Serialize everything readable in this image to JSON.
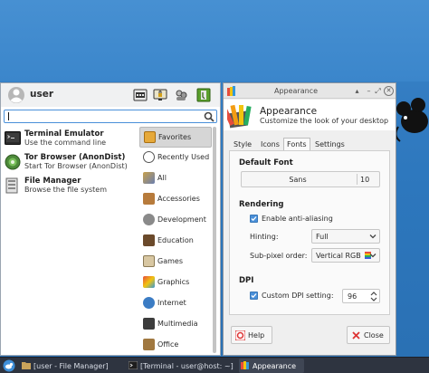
{
  "menu": {
    "user_name": "user",
    "header_buttons": [
      "settings-manager-icon",
      "lock-screen-icon",
      "switch-user-icon",
      "log-out-icon"
    ],
    "search": {
      "value": "",
      "placeholder": ""
    },
    "favorites": [
      {
        "name": "Terminal Emulator",
        "desc": "Use the command line",
        "icon": "terminal-icon"
      },
      {
        "name": "Tor Browser (AnonDist)",
        "desc": "Start Tor Browser (AnonDist)",
        "icon": "tor-browser-icon"
      },
      {
        "name": "File Manager",
        "desc": "Browse the file system",
        "icon": "file-manager-icon"
      }
    ],
    "categories": [
      {
        "label": "Favorites",
        "icon": "favorites-icon",
        "selected": true
      },
      {
        "label": "Recently Used",
        "icon": "recently-used-icon"
      },
      {
        "label": "All",
        "icon": "all-apps-icon"
      },
      {
        "label": "Accessories",
        "icon": "accessories-icon"
      },
      {
        "label": "Development",
        "icon": "development-icon"
      },
      {
        "label": "Education",
        "icon": "education-icon"
      },
      {
        "label": "Games",
        "icon": "games-icon"
      },
      {
        "label": "Graphics",
        "icon": "graphics-icon"
      },
      {
        "label": "Internet",
        "icon": "internet-icon"
      },
      {
        "label": "Multimedia",
        "icon": "multimedia-icon"
      },
      {
        "label": "Office",
        "icon": "office-icon"
      }
    ]
  },
  "appearance": {
    "window_title": "Appearance",
    "heading": "Appearance",
    "subtitle": "Customize the look of your desktop",
    "tabs": [
      "Style",
      "Icons",
      "Fonts",
      "Settings"
    ],
    "active_tab": "Fonts",
    "default_font_heading": "Default Font",
    "font_name": "Sans",
    "font_size": "10",
    "rendering_heading": "Rendering",
    "antialias_label": "Enable anti-aliasing",
    "antialias_checked": true,
    "hinting_label": "Hinting:",
    "hinting_value": "Full",
    "subpixel_label": "Sub-pixel order:",
    "subpixel_value": "Vertical RGB",
    "dpi_heading": "DPI",
    "custom_dpi_label": "Custom DPI setting:",
    "custom_dpi_checked": true,
    "dpi_value": "96",
    "help_label": "Help",
    "close_label": "Close"
  },
  "taskbar": {
    "tasks": [
      {
        "label": "[user - File Manager]",
        "icon": "folder-icon",
        "active": false
      },
      {
        "label": "[Terminal - user@host: ~]",
        "icon": "terminal-icon",
        "active": false
      },
      {
        "label": "Appearance",
        "icon": "appearance-icon",
        "active": true
      }
    ]
  },
  "colors": {
    "desktop": "#2d77bd",
    "accent": "#4a90d9",
    "taskbar": "#2e3440",
    "selection": "#d6d6d6"
  }
}
